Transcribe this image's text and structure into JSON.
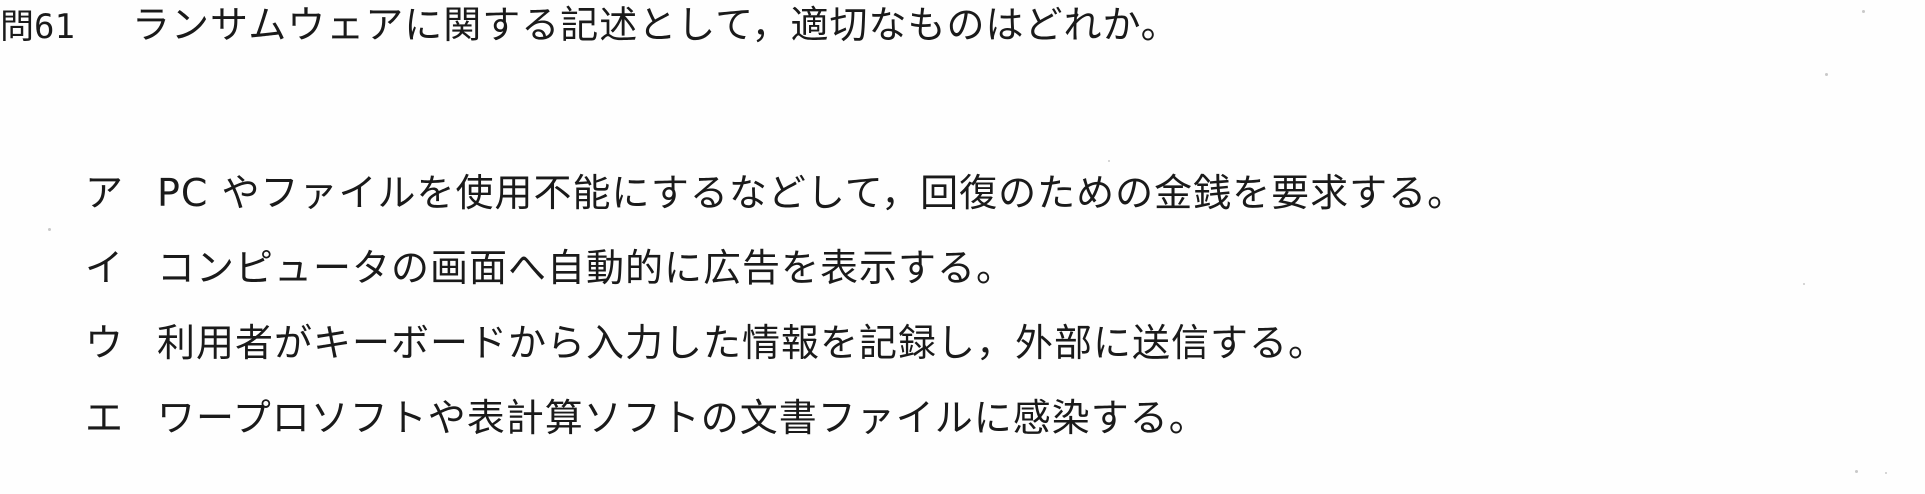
{
  "question": {
    "number": "問61",
    "text": "ランサムウェアに関する記述として，適切なものはどれか。"
  },
  "choices": [
    {
      "marker": "ア",
      "text": "PC やファイルを使用不能にするなどして，回復のための金銭を要求する。"
    },
    {
      "marker": "イ",
      "text": "コンピュータの画面へ自動的に広告を表示する。"
    },
    {
      "marker": "ウ",
      "text": "利用者がキーボードから入力した情報を記録し，外部に送信する。"
    },
    {
      "marker": "エ",
      "text": "ワープロソフトや表計算ソフトの文書ファイルに感染する。"
    }
  ]
}
